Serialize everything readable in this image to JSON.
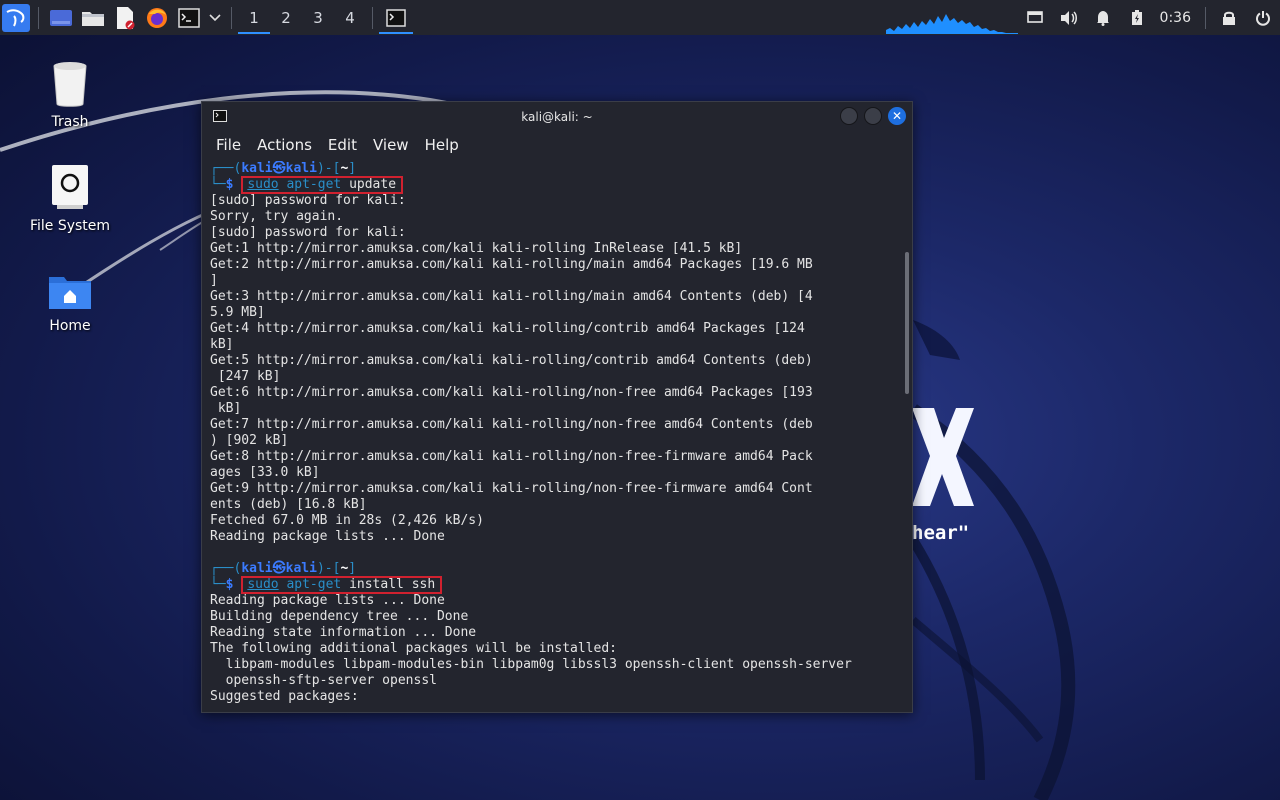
{
  "taskbar": {
    "workspaces": [
      "1",
      "2",
      "3",
      "4"
    ],
    "active_workspace": "1",
    "clock": "0:36"
  },
  "desktop": {
    "icons": [
      {
        "label": "Trash"
      },
      {
        "label": "File System"
      },
      {
        "label": "Home"
      }
    ],
    "wallpaper_quote_fragment": "hear\""
  },
  "terminal": {
    "title": "kali@kali: ~",
    "menu": [
      "File",
      "Actions",
      "Edit",
      "View",
      "Help"
    ],
    "prompt": {
      "open": "┌──(",
      "user": "kali",
      "at": "㉿",
      "host": "kali",
      "close": ")-[",
      "dir": "~",
      "end": "]",
      "second": "└─",
      "dollar": "$"
    },
    "cmd1": {
      "sudo": "sudo",
      "bin": "apt-get",
      "args": "update"
    },
    "output1": [
      "[sudo] password for kali:",
      "Sorry, try again.",
      "[sudo] password for kali:",
      "Get:1 http://mirror.amuksa.com/kali kali-rolling InRelease [41.5 kB]",
      "Get:2 http://mirror.amuksa.com/kali kali-rolling/main amd64 Packages [19.6 MB",
      "]",
      "Get:3 http://mirror.amuksa.com/kali kali-rolling/main amd64 Contents (deb) [4",
      "5.9 MB]",
      "Get:4 http://mirror.amuksa.com/kali kali-rolling/contrib amd64 Packages [124",
      "kB]",
      "Get:5 http://mirror.amuksa.com/kali kali-rolling/contrib amd64 Contents (deb)",
      " [247 kB]",
      "Get:6 http://mirror.amuksa.com/kali kali-rolling/non-free amd64 Packages [193",
      " kB]",
      "Get:7 http://mirror.amuksa.com/kali kali-rolling/non-free amd64 Contents (deb",
      ") [902 kB]",
      "Get:8 http://mirror.amuksa.com/kali kali-rolling/non-free-firmware amd64 Pack",
      "ages [33.0 kB]",
      "Get:9 http://mirror.amuksa.com/kali kali-rolling/non-free-firmware amd64 Cont",
      "ents (deb) [16.8 kB]",
      "Fetched 67.0 MB in 28s (2,426 kB/s)",
      "Reading package lists ... Done",
      ""
    ],
    "cmd2": {
      "sudo": "sudo",
      "bin": "apt-get",
      "args": "install ssh"
    },
    "output2": [
      "Reading package lists ... Done",
      "Building dependency tree ... Done",
      "Reading state information ... Done",
      "The following additional packages will be installed:",
      "  libpam-modules libpam-modules-bin libpam0g libssl3 openssh-client openssh-server",
      "  openssh-sftp-server openssl",
      "Suggested packages:"
    ]
  }
}
